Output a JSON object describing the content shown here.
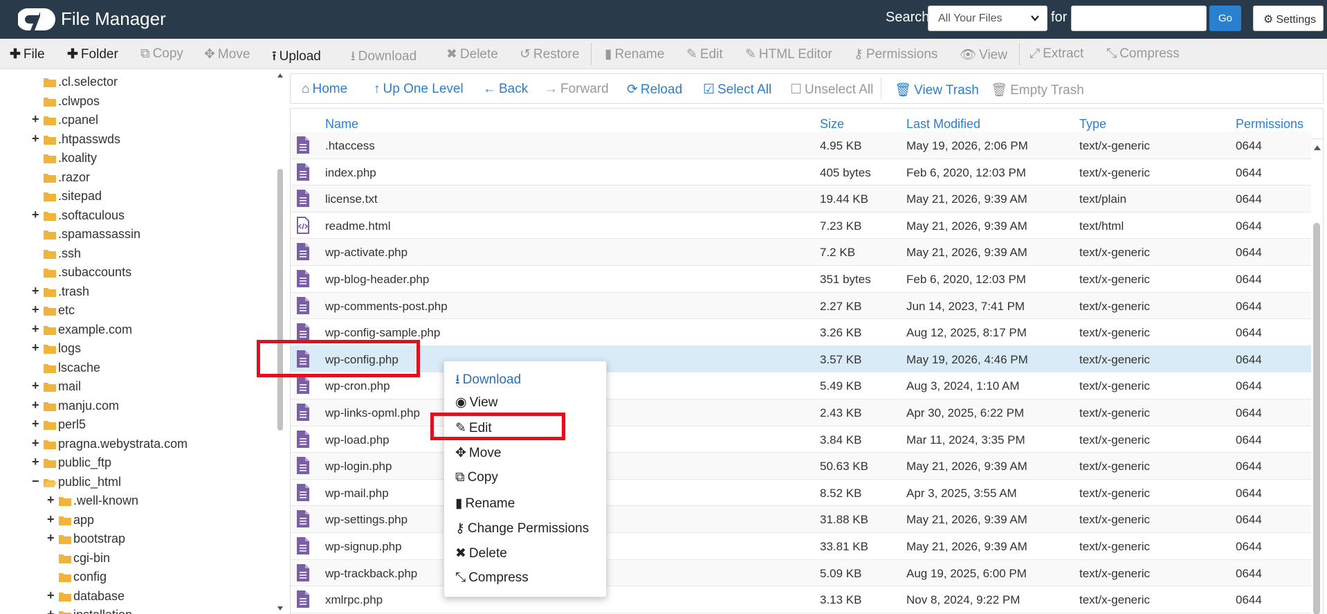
{
  "app": {
    "title": "File Manager",
    "search_label": "Search",
    "search_scope": "All Your Files",
    "for_label": "for",
    "search_value": "",
    "go_label": "Go",
    "settings_label": "Settings"
  },
  "toolbar": {
    "file": "File",
    "folder": "Folder",
    "copy": "Copy",
    "move": "Move",
    "upload": "Upload",
    "download": "Download",
    "delete": "Delete",
    "restore": "Restore",
    "rename": "Rename",
    "edit": "Edit",
    "html_editor": "HTML Editor",
    "permissions": "Permissions",
    "view": "View",
    "extract": "Extract",
    "compress": "Compress"
  },
  "nav": {
    "home": "Home",
    "up": "Up One Level",
    "back": "Back",
    "forward": "Forward",
    "reload": "Reload",
    "select_all": "Select All",
    "unselect_all": "Unselect All",
    "view_trash": "View Trash",
    "empty_trash": "Empty Trash"
  },
  "tree": [
    {
      "label": ".cl.selector",
      "expandable": false,
      "open": false
    },
    {
      "label": ".clwpos",
      "expandable": false,
      "open": false
    },
    {
      "label": ".cpanel",
      "expandable": true,
      "open": false
    },
    {
      "label": ".htpasswds",
      "expandable": true,
      "open": false
    },
    {
      "label": ".koality",
      "expandable": false,
      "open": false
    },
    {
      "label": ".razor",
      "expandable": false,
      "open": false
    },
    {
      "label": ".sitepad",
      "expandable": false,
      "open": false
    },
    {
      "label": ".softaculous",
      "expandable": true,
      "open": false
    },
    {
      "label": ".spamassassin",
      "expandable": false,
      "open": false
    },
    {
      "label": ".ssh",
      "expandable": false,
      "open": false
    },
    {
      "label": ".subaccounts",
      "expandable": false,
      "open": false
    },
    {
      "label": ".trash",
      "expandable": true,
      "open": false
    },
    {
      "label": "etc",
      "expandable": true,
      "open": false
    },
    {
      "label": "example.com",
      "expandable": true,
      "open": false
    },
    {
      "label": "logs",
      "expandable": true,
      "open": false
    },
    {
      "label": "lscache",
      "expandable": false,
      "open": false
    },
    {
      "label": "mail",
      "expandable": true,
      "open": false
    },
    {
      "label": "manju.com",
      "expandable": true,
      "open": false
    },
    {
      "label": "perl5",
      "expandable": true,
      "open": false
    },
    {
      "label": "pragna.webystrata.com",
      "expandable": true,
      "open": false
    },
    {
      "label": "public_ftp",
      "expandable": true,
      "open": false
    },
    {
      "label": "public_html",
      "expandable": true,
      "open": true
    },
    {
      "label": ".well-known",
      "expandable": true,
      "open": false,
      "child": true
    },
    {
      "label": "app",
      "expandable": true,
      "open": false,
      "child": true
    },
    {
      "label": "bootstrap",
      "expandable": true,
      "open": false,
      "child": true
    },
    {
      "label": "cgi-bin",
      "expandable": false,
      "open": false,
      "child": true
    },
    {
      "label": "config",
      "expandable": false,
      "open": false,
      "child": true
    },
    {
      "label": "database",
      "expandable": true,
      "open": false,
      "child": true
    },
    {
      "label": "installation",
      "expandable": true,
      "open": false,
      "child": true
    }
  ],
  "table": {
    "headers": {
      "name": "Name",
      "size": "Size",
      "modified": "Last Modified",
      "type": "Type",
      "perms": "Permissions"
    },
    "rows": [
      {
        "name": ".htaccess",
        "size": "4.95 KB",
        "modified": "May 19, 2026, 2:06 PM",
        "type": "text/x-generic",
        "perms": "0644",
        "icon": "file-text-icon"
      },
      {
        "name": "index.php",
        "size": "405 bytes",
        "modified": "Feb 6, 2020, 12:03 PM",
        "type": "text/x-generic",
        "perms": "0644",
        "icon": "file-text-icon"
      },
      {
        "name": "license.txt",
        "size": "19.44 KB",
        "modified": "May 21, 2026, 9:39 AM",
        "type": "text/plain",
        "perms": "0644",
        "icon": "file-text-icon"
      },
      {
        "name": "readme.html",
        "size": "7.23 KB",
        "modified": "May 21, 2026, 9:39 AM",
        "type": "text/html",
        "perms": "0644",
        "icon": "file-code-icon"
      },
      {
        "name": "wp-activate.php",
        "size": "7.2 KB",
        "modified": "May 21, 2026, 9:39 AM",
        "type": "text/x-generic",
        "perms": "0644",
        "icon": "file-text-icon"
      },
      {
        "name": "wp-blog-header.php",
        "size": "351 bytes",
        "modified": "Feb 6, 2020, 12:03 PM",
        "type": "text/x-generic",
        "perms": "0644",
        "icon": "file-text-icon"
      },
      {
        "name": "wp-comments-post.php",
        "size": "2.27 KB",
        "modified": "Jun 14, 2023, 7:41 PM",
        "type": "text/x-generic",
        "perms": "0644",
        "icon": "file-text-icon"
      },
      {
        "name": "wp-config-sample.php",
        "size": "3.26 KB",
        "modified": "Aug 12, 2025, 8:17 PM",
        "type": "text/x-generic",
        "perms": "0644",
        "icon": "file-text-icon"
      },
      {
        "name": "wp-config.php",
        "size": "3.57 KB",
        "modified": "May 19, 2026, 4:46 PM",
        "type": "text/x-generic",
        "perms": "0644",
        "icon": "file-text-icon",
        "selected": true
      },
      {
        "name": "wp-cron.php",
        "size": "5.49 KB",
        "modified": "Aug 3, 2024, 1:10 AM",
        "type": "text/x-generic",
        "perms": "0644",
        "icon": "file-text-icon"
      },
      {
        "name": "wp-links-opml.php",
        "size": "2.43 KB",
        "modified": "Apr 30, 2025, 6:22 PM",
        "type": "text/x-generic",
        "perms": "0644",
        "icon": "file-text-icon"
      },
      {
        "name": "wp-load.php",
        "size": "3.84 KB",
        "modified": "Mar 11, 2024, 3:35 PM",
        "type": "text/x-generic",
        "perms": "0644",
        "icon": "file-text-icon"
      },
      {
        "name": "wp-login.php",
        "size": "50.63 KB",
        "modified": "May 21, 2026, 9:39 AM",
        "type": "text/x-generic",
        "perms": "0644",
        "icon": "file-text-icon"
      },
      {
        "name": "wp-mail.php",
        "size": "8.52 KB",
        "modified": "Apr 3, 2025, 3:55 AM",
        "type": "text/x-generic",
        "perms": "0644",
        "icon": "file-text-icon"
      },
      {
        "name": "wp-settings.php",
        "size": "31.88 KB",
        "modified": "May 21, 2026, 9:39 AM",
        "type": "text/x-generic",
        "perms": "0644",
        "icon": "file-text-icon"
      },
      {
        "name": "wp-signup.php",
        "size": "33.81 KB",
        "modified": "May 21, 2026, 9:39 AM",
        "type": "text/x-generic",
        "perms": "0644",
        "icon": "file-text-icon"
      },
      {
        "name": "wp-trackback.php",
        "size": "5.09 KB",
        "modified": "Aug 19, 2025, 6:00 PM",
        "type": "text/x-generic",
        "perms": "0644",
        "icon": "file-text-icon"
      },
      {
        "name": "xmlrpc.php",
        "size": "3.13 KB",
        "modified": "Nov 8, 2024, 9:22 PM",
        "type": "text/x-generic",
        "perms": "0644",
        "icon": "file-text-icon"
      }
    ]
  },
  "context_menu": [
    {
      "label": "Download",
      "icon": "download-icon"
    },
    {
      "label": "View",
      "icon": "eye-icon"
    },
    {
      "label": "Edit",
      "icon": "pencil-icon"
    },
    {
      "label": "Move",
      "icon": "move-icon"
    },
    {
      "label": "Copy",
      "icon": "copy-icon"
    },
    {
      "label": "Rename",
      "icon": "file-icon"
    },
    {
      "label": "Change Permissions",
      "icon": "key-icon"
    },
    {
      "label": "Delete",
      "icon": "times-icon"
    },
    {
      "label": "Compress",
      "icon": "compress-icon"
    }
  ],
  "colors": {
    "header_bg": "#293a4a",
    "accent": "#2a7fcf",
    "folder": "#f0b43c",
    "file_icon": "#7a5ea6",
    "highlight": "#e0111d",
    "selected_row": "#d9ebf7"
  }
}
